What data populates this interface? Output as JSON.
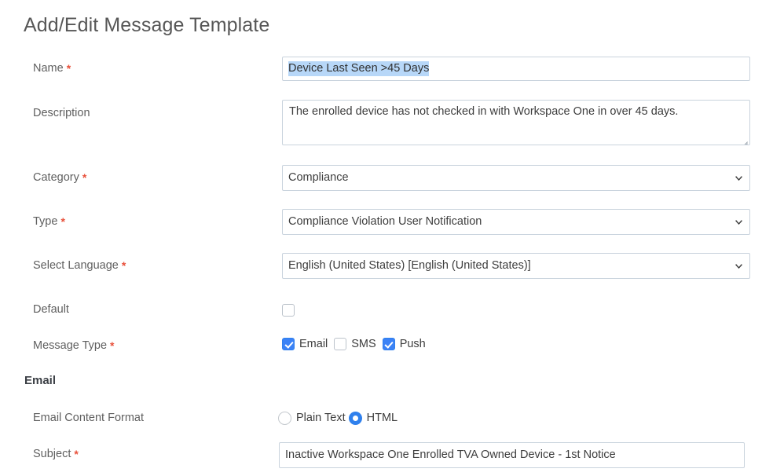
{
  "page": {
    "title": "Add/Edit Message Template"
  },
  "fields": {
    "name": {
      "label": "Name",
      "required": "*",
      "value": "Device Last Seen >45 Days",
      "placeholder": ""
    },
    "description": {
      "label": "Description",
      "value": "The enrolled device has not checked in with Workspace One in over 45 days.",
      "placeholder": ""
    },
    "category": {
      "label": "Category",
      "required": "*",
      "value": "Compliance",
      "icon": "chevron-down-icon"
    },
    "type": {
      "label": "Type",
      "required": "*",
      "value": "Compliance Violation User Notification",
      "icon": "chevron-down-icon"
    },
    "select_language": {
      "label": "Select Language",
      "required": "*",
      "value": "English (United States) [English (United States)]",
      "icon": "chevron-down-icon"
    },
    "default": {
      "label": "Default",
      "checked": false
    },
    "message_type": {
      "label": "Message Type",
      "required": "*",
      "options": [
        {
          "label": "Email",
          "checked": true
        },
        {
          "label": "SMS",
          "checked": false
        },
        {
          "label": "Push",
          "checked": true
        }
      ]
    }
  },
  "email_section": {
    "header": "Email",
    "content_format": {
      "label": "Email Content Format",
      "options": [
        {
          "label": "Plain Text",
          "selected": false
        },
        {
          "label": "HTML",
          "selected": true
        }
      ]
    },
    "subject": {
      "label": "Subject",
      "required": "*",
      "value": "Inactive Workspace One Enrolled TVA Owned Device - 1st Notice",
      "placeholder": ""
    }
  },
  "colors": {
    "accent_blue": "#3b82f6",
    "radio_blue": "#2f80ed",
    "required_red": "#e8503a",
    "selection_blue": "#b7d7f8",
    "border_gray": "#c9d3dd",
    "title_gray": "#575757",
    "label_gray": "#5f5f5f"
  }
}
